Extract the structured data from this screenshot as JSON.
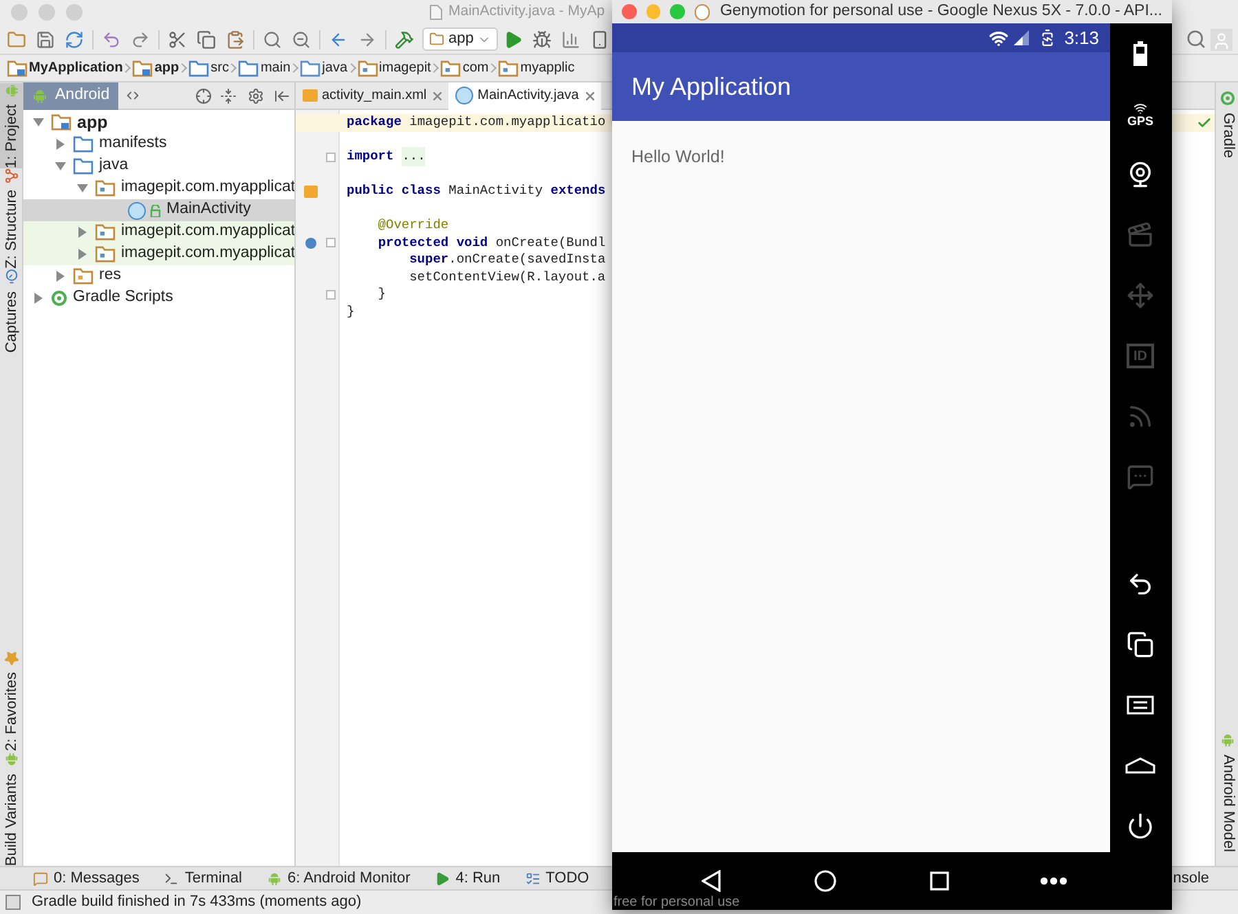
{
  "ide": {
    "title": "MainActivity.java - MyAp",
    "run_config": "app",
    "breadcrumbs": [
      {
        "label": "MyApplication",
        "kind": "module"
      },
      {
        "label": "app",
        "kind": "module"
      },
      {
        "label": "src",
        "kind": "folder"
      },
      {
        "label": "main",
        "kind": "folder"
      },
      {
        "label": "java",
        "kind": "source"
      },
      {
        "label": "imagepit",
        "kind": "package"
      },
      {
        "label": "com",
        "kind": "package"
      },
      {
        "label": "myapplic",
        "kind": "package"
      }
    ],
    "left_tool_tabs_top": [
      {
        "label": "1: Project",
        "kind": "project",
        "selected": true
      },
      {
        "label": "Z: Structure",
        "kind": "structure",
        "selected": false
      },
      {
        "label": "Captures",
        "kind": "captures",
        "selected": false
      }
    ],
    "left_tool_tabs_bottom": [
      {
        "label": "2: Favorites",
        "kind": "favorites",
        "selected": false
      },
      {
        "label": "Build Variants",
        "kind": "variants",
        "selected": false
      }
    ],
    "project_view": "Android",
    "tree": [
      {
        "label": "app",
        "kind": "module",
        "expanded": true,
        "selected": false,
        "tinted": false,
        "children": [
          {
            "label": "manifests",
            "kind": "folder",
            "expanded": false,
            "selected": false,
            "tinted": false
          },
          {
            "label": "java",
            "kind": "folder",
            "expanded": true,
            "selected": false,
            "tinted": false,
            "children": [
              {
                "label": "imagepit.com.myapplicat",
                "kind": "package",
                "expanded": true,
                "selected": false,
                "tinted": false,
                "children": [
                  {
                    "label": "MainActivity",
                    "kind": "class",
                    "selected": true,
                    "tinted": false
                  }
                ]
              },
              {
                "label": "imagepit.com.myapplicat",
                "kind": "package",
                "expanded": false,
                "selected": false,
                "tinted": true
              },
              {
                "label": "imagepit.com.myapplicat",
                "kind": "package",
                "expanded": false,
                "selected": false,
                "tinted": true
              }
            ]
          },
          {
            "label": "res",
            "kind": "res",
            "expanded": false,
            "selected": false,
            "tinted": false
          }
        ]
      },
      {
        "label": "Gradle Scripts",
        "kind": "gradle",
        "expanded": false,
        "selected": false,
        "tinted": false
      }
    ],
    "editor_tabs": [
      {
        "label": "activity_main.xml",
        "kind": "xml",
        "selected": false
      },
      {
        "label": "MainActivity.java",
        "kind": "class",
        "selected": true
      }
    ],
    "code_lines": [
      {
        "kind": "code",
        "text": "**package** imagepit.com.myapplicatio",
        "gap_before": false,
        "current": true,
        "fold": false,
        "layout_link": false,
        "override": false
      },
      {
        "kind": "import",
        "text": "**import**",
        "folded": "...",
        "gap_before": true,
        "current": false,
        "fold": true,
        "layout_link": false,
        "override": false
      },
      {
        "kind": "code",
        "text": "**public class** MainActivity **extends**",
        "gap_before": true,
        "current": false,
        "fold": false,
        "layout_link": true,
        "override": false
      },
      {
        "kind": "annotation",
        "text": "    @Override",
        "gap_before": true,
        "current": false,
        "fold": false,
        "layout_link": false,
        "override": false
      },
      {
        "kind": "code",
        "text": "    **protected void** onCreate(Bundl",
        "gap_before": false,
        "current": false,
        "fold": true,
        "layout_link": false,
        "override": true
      },
      {
        "kind": "code",
        "text": "        **super**.onCreate(savedInsta",
        "gap_before": false,
        "current": false,
        "fold": false,
        "layout_link": false,
        "override": false
      },
      {
        "kind": "code",
        "text": "        setContentView(R.layout.a",
        "gap_before": false,
        "current": false,
        "fold": false,
        "layout_link": false,
        "override": false
      },
      {
        "kind": "code",
        "text": "    }",
        "gap_before": false,
        "current": false,
        "fold": true,
        "layout_link": false,
        "override": false
      },
      {
        "kind": "code",
        "text": "}",
        "gap_before": false,
        "current": false,
        "fold": false,
        "layout_link": false,
        "override": false
      }
    ],
    "right_tool_tabs": [
      {
        "label": "Gradle",
        "kind": "gradle"
      },
      {
        "label": "Android Model",
        "kind": "android"
      }
    ],
    "bottom_tool_tabs": [
      {
        "label": "0: Messages",
        "kind": "messages"
      },
      {
        "label": "Terminal",
        "kind": "terminal"
      },
      {
        "label": "6: Android Monitor",
        "kind": "android"
      },
      {
        "label": "4: Run",
        "kind": "run"
      },
      {
        "label": "TODO",
        "kind": "todo"
      }
    ],
    "bottom_tool_tab_cut": "nsole",
    "status": "Gradle build finished in 7s 433ms (moments ago)"
  },
  "emulator": {
    "title": "Genymotion for personal use - Google Nexus 5X - 7.0.0 - API...",
    "time": "3:13",
    "app_title": "My Application",
    "content_text": "Hello World!",
    "overlay_text": "free for personal use",
    "nav_buttons": [
      {
        "kind": "back"
      },
      {
        "kind": "home"
      },
      {
        "kind": "recents"
      },
      {
        "kind": "more"
      }
    ],
    "sidebar_top": [
      {
        "kind": "battery",
        "disabled": false
      },
      {
        "kind": "gps",
        "label": "GPS",
        "disabled": false
      },
      {
        "kind": "camera",
        "disabled": false
      },
      {
        "kind": "media",
        "disabled": true
      },
      {
        "kind": "dpad",
        "disabled": true
      },
      {
        "kind": "id",
        "label": "ID",
        "disabled": true
      },
      {
        "kind": "cast",
        "disabled": true
      },
      {
        "kind": "sms",
        "disabled": true
      }
    ],
    "sidebar_bottom": [
      {
        "kind": "back",
        "disabled": false
      },
      {
        "kind": "recents",
        "disabled": false
      },
      {
        "kind": "menu",
        "disabled": false
      },
      {
        "kind": "home",
        "disabled": false
      },
      {
        "kind": "power",
        "disabled": false
      }
    ]
  }
}
